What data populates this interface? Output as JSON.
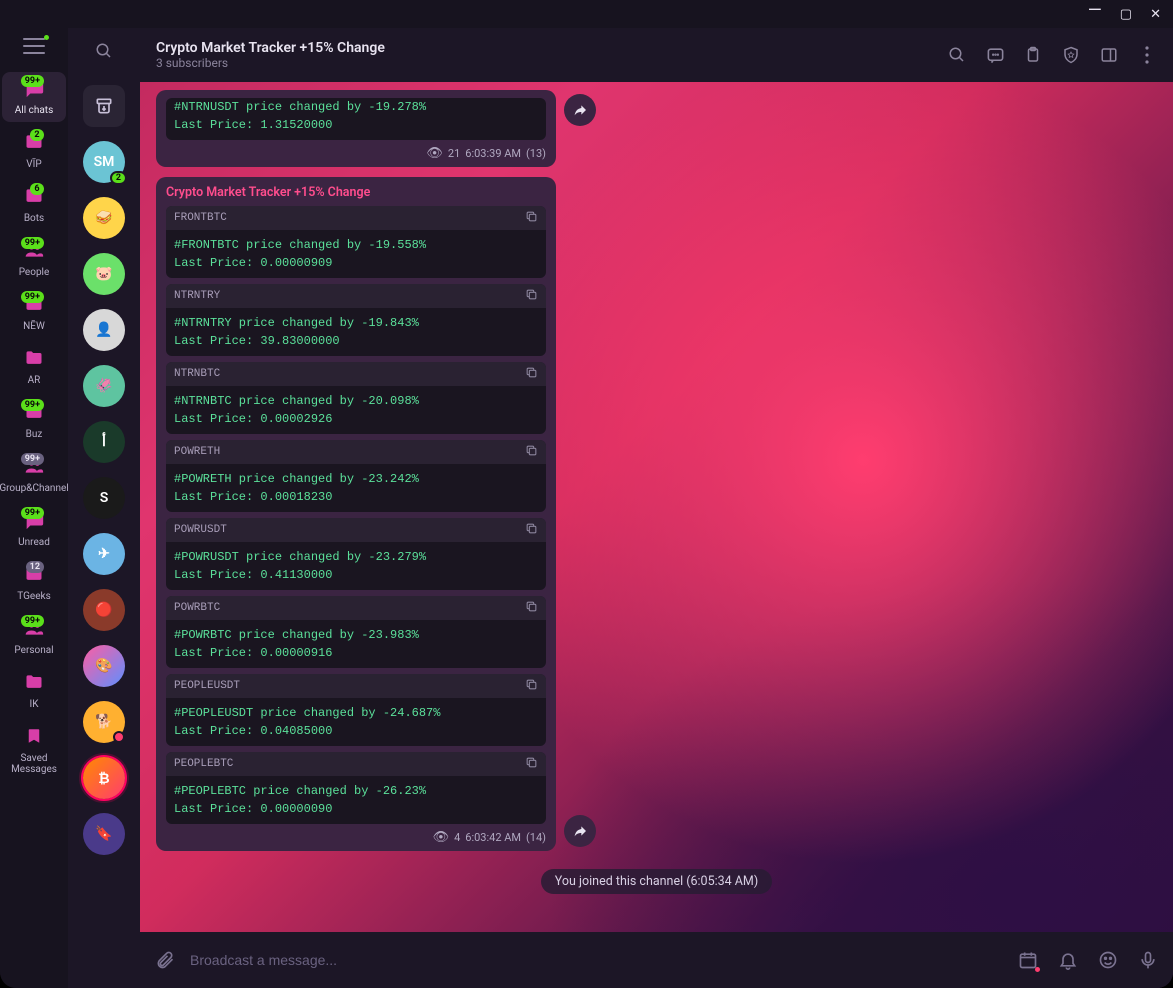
{
  "window": {
    "title": "Crypto Market Tracker +15% Change",
    "subscribers": "3 subscribers"
  },
  "folders": [
    {
      "label": "All chats",
      "badge": "99+",
      "active": true,
      "icon": "chat"
    },
    {
      "label": "VĪP",
      "badge": "2",
      "icon": "folder"
    },
    {
      "label": "Bots",
      "badge": "6",
      "icon": "folder"
    },
    {
      "label": "People",
      "badge": "99+",
      "icon": "people"
    },
    {
      "label": "NĒW",
      "badge": "99+",
      "icon": "folder"
    },
    {
      "label": "AR",
      "badge": "",
      "icon": "folder"
    },
    {
      "label": "Buz",
      "badge": "99+",
      "icon": "folder"
    },
    {
      "label": "Group&Channel",
      "badge": "99+",
      "icon": "people",
      "gray": true
    },
    {
      "label": "Unread",
      "badge": "99+",
      "icon": "chat"
    },
    {
      "label": "TGeeks",
      "badge": "12",
      "icon": "folder",
      "gray": true
    },
    {
      "label": "Personal",
      "badge": "99+",
      "icon": "people"
    },
    {
      "label": "IK",
      "badge": "",
      "icon": "folder"
    },
    {
      "label": "Saved Messages",
      "badge": "",
      "icon": "bookmark"
    }
  ],
  "chats": [
    {
      "bg": "#2a2434",
      "label": "↓",
      "type": "archive"
    },
    {
      "bg": "#6bc4d4",
      "label": "SM",
      "badge": "2"
    },
    {
      "bg": "#ffd54a",
      "label": "🥪"
    },
    {
      "bg": "#6be06a",
      "label": "🐷"
    },
    {
      "bg": "#d8d8d8",
      "label": "👤"
    },
    {
      "bg": "#5ec4a0",
      "label": "🦑"
    },
    {
      "bg": "#1a3a2a",
      "label": "أ"
    },
    {
      "bg": "#1a1a1a",
      "label": "S"
    },
    {
      "bg": "#6bb4e4",
      "label": "✈"
    },
    {
      "bg": "#8a3a2a",
      "label": "🔴"
    },
    {
      "bg": "linear-gradient(135deg,#ff5da2,#5d8fff)",
      "label": "🎨"
    },
    {
      "bg": "#ffb030",
      "label": "🐕",
      "dot": true
    },
    {
      "bg": "linear-gradient(135deg,#ff8a00,#ff3d6f)",
      "label": "₿",
      "selected": true
    },
    {
      "bg": "#4a3a8a",
      "label": "🔖"
    }
  ],
  "truncated_first": {
    "line1_partial": "#NTRNUSDT price changed by -19.278%",
    "line2": "Last Price: 1.31520000",
    "views": "21",
    "time": "6:03:39 AM",
    "count": "(13)"
  },
  "sender": "Crypto Market Tracker +15% Change",
  "codeblocks": [
    {
      "title": "FRONTBTC",
      "line1": "#FRONTBTC price changed by -19.558%",
      "line2": "Last Price: 0.00000909"
    },
    {
      "title": "NTRNTRY",
      "line1": "#NTRNTRY price changed by -19.843%",
      "line2": "Last Price: 39.83000000"
    },
    {
      "title": "NTRNBTC",
      "line1": "#NTRNBTC price changed by -20.098%",
      "line2": "Last Price: 0.00002926"
    },
    {
      "title": "POWRETH",
      "line1": "#POWRETH price changed by -23.242%",
      "line2": "Last Price: 0.00018230"
    },
    {
      "title": "POWRUSDT",
      "line1": "#POWRUSDT price changed by -23.279%",
      "line2": "Last Price: 0.41130000"
    },
    {
      "title": "POWRBTC",
      "line1": "#POWRBTC price changed by -23.983%",
      "line2": "Last Price: 0.00000916"
    },
    {
      "title": "PEOPLEUSDT",
      "line1": "#PEOPLEUSDT price changed by -24.687%",
      "line2": "Last Price: 0.04085000"
    },
    {
      "title": "PEOPLEBTC",
      "line1": "#PEOPLEBTC price changed by -26.23%",
      "line2": "Last Price: 0.00000090"
    }
  ],
  "msg2_meta": {
    "views": "4",
    "time": "6:03:42 AM",
    "count": "(14)"
  },
  "joined": "You joined this channel (6:05:34 AM)",
  "input_placeholder": "Broadcast a message..."
}
